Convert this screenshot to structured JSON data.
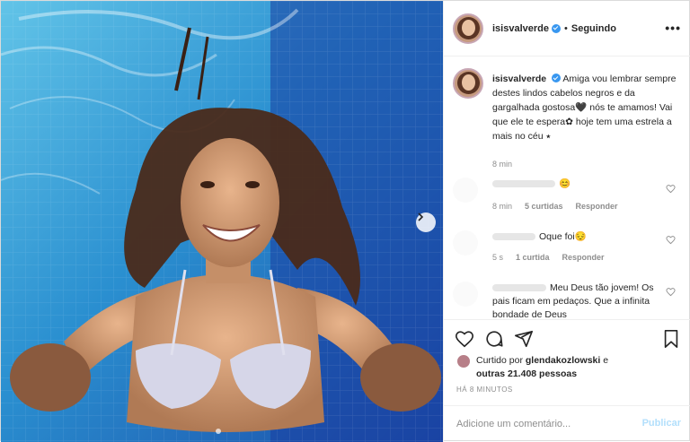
{
  "post": {
    "username": "isisvalverde",
    "follow_status": "Seguindo",
    "separator": "•",
    "more": "•••",
    "caption": "Amiga vou lembrar sempre destes lindos cabelos negros e da gargalhada gostosa🖤 nós te amamos! Vai que ele te espera✿ hoje tem uma estrela a mais no céu ⭑",
    "caption_time": "8 min"
  },
  "comments": [
    {
      "text": "😊",
      "time": "8 min",
      "likes": "5 curtidas",
      "reply": "Responder"
    },
    {
      "text": "Oque foi😔",
      "time": "5 s",
      "likes": "1 curtida",
      "reply": "Responder"
    },
    {
      "text": "Meu Deus tão jovem! Os pais ficam em pedaços. Que a infinita bondade de Deus"
    }
  ],
  "likes": {
    "prefix": "Curtido por",
    "user": "glendakozlowski",
    "conj": "e",
    "others": "outras 21.408 pessoas"
  },
  "timestamp": "HÁ 8 MINUTOS",
  "comment_box": {
    "placeholder": "Adicione um comentário...",
    "publish": "Publicar"
  },
  "colors": {
    "accent": "#3897f0",
    "publish_disabled": "#b2dffc",
    "muted": "#8e8e8e"
  },
  "icons": [
    "verified-icon",
    "more-options-icon",
    "next-arrow-icon",
    "heart-icon",
    "comment-icon",
    "share-icon",
    "bookmark-icon"
  ]
}
